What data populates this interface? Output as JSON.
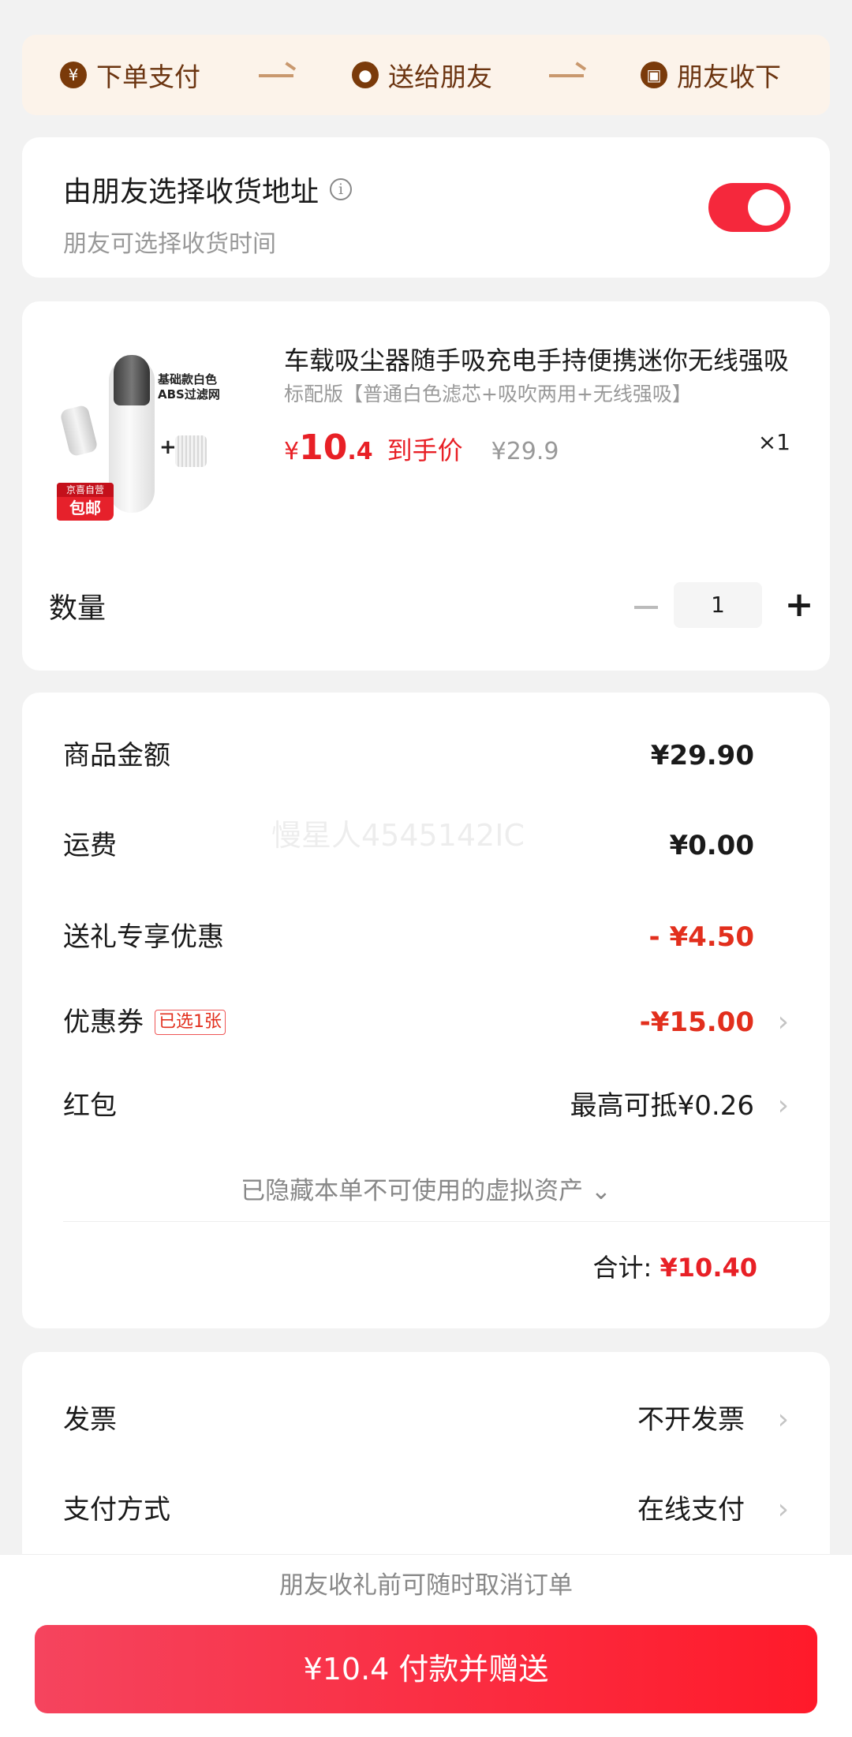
{
  "steps": [
    {
      "icon": "yen-icon",
      "glyph": "¥",
      "label": "下单支付"
    },
    {
      "icon": "wechat-icon",
      "glyph": "●",
      "label": "送给朋友"
    },
    {
      "icon": "gift-icon",
      "glyph": "▣",
      "label": "朋友收下"
    }
  ],
  "address": {
    "title": "由朋友选择收货地址",
    "subtitle": "朋友可选择收货时间",
    "toggle_on": true,
    "accent": "#f5283c"
  },
  "product": {
    "title": "车载吸尘器随手吸充电手持便携迷你无线强吸",
    "spec": "标配版【普通白色滤芯+吸吹两用+无线强吸】",
    "image_text": "基础款白色\nABS过滤网",
    "badge_top": "京喜自营",
    "badge_bottom": "包邮",
    "price_currency": "¥",
    "price_int": "10",
    "price_dec": ".4",
    "price_tag": "到手价",
    "original_price": "¥29.9",
    "count": "×1"
  },
  "quantity": {
    "label": "数量",
    "value": "1"
  },
  "summary": {
    "goods_label": "商品金额",
    "goods_value": "¥29.90",
    "shipping_label": "运费",
    "shipping_value": "¥0.00",
    "gift_label": "送礼专享优惠",
    "gift_value": "- ¥4.50",
    "coupon_label": "优惠券",
    "coupon_tag": "已选1张",
    "coupon_value": "-¥15.00",
    "redpacket_label": "红包",
    "redpacket_value": "最高可抵¥0.26",
    "hidden_note": "已隐藏本单不可使用的虚拟资产 ⌄",
    "total_label": "合计:",
    "total_value": "¥10.40",
    "watermark": "慢星人4545142IC"
  },
  "options": {
    "invoice_label": "发票",
    "invoice_value": "不开发票",
    "payment_label": "支付方式",
    "payment_value": "在线支付"
  },
  "footer": {
    "cancel_note": "朋友收礼前可随时取消订单",
    "pay_button": "¥10.4 付款并赠送"
  },
  "colors": {
    "red": "#e82026",
    "brown": "#6b3410",
    "gray": "#999999"
  }
}
